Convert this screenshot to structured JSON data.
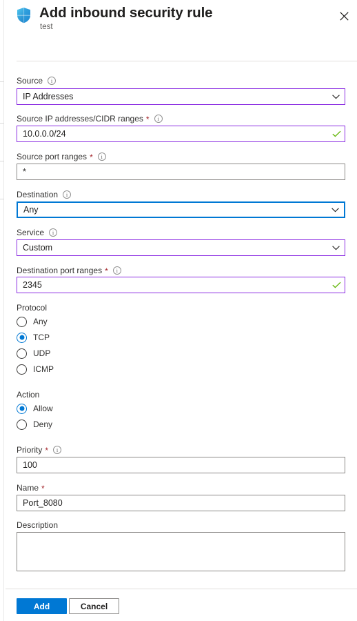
{
  "header": {
    "icon": "shield-icon",
    "title": "Add inbound security rule",
    "subtitle": "test",
    "close_label": "Close"
  },
  "colors": {
    "accent": "#0078d4",
    "modified_border": "#8a2be2",
    "neutral_border": "#8a8886",
    "required_star": "#a4262c",
    "valid_check": "#5db300",
    "label_text": "#323130"
  },
  "form": {
    "source": {
      "label": "Source",
      "required": false,
      "has_info": true,
      "value": "IP Addresses",
      "type": "dropdown",
      "state": "modified"
    },
    "source_ip": {
      "label": "Source IP addresses/CIDR ranges",
      "required": true,
      "has_info": true,
      "value": "10.0.0.0/24",
      "type": "text",
      "state": "modified",
      "valid": true
    },
    "source_port": {
      "label": "Source port ranges",
      "required": true,
      "has_info": true,
      "value": "*",
      "type": "text",
      "state": "default"
    },
    "destination": {
      "label": "Destination",
      "required": false,
      "has_info": true,
      "value": "Any",
      "type": "dropdown",
      "state": "focused"
    },
    "service": {
      "label": "Service",
      "required": false,
      "has_info": true,
      "value": "Custom",
      "type": "dropdown",
      "state": "modified"
    },
    "dest_port": {
      "label": "Destination port ranges",
      "required": true,
      "has_info": true,
      "value": "2345",
      "type": "text",
      "state": "modified",
      "valid": true
    },
    "protocol": {
      "label": "Protocol",
      "options": [
        {
          "label": "Any",
          "selected": false
        },
        {
          "label": "TCP",
          "selected": true
        },
        {
          "label": "UDP",
          "selected": false
        },
        {
          "label": "ICMP",
          "selected": false
        }
      ]
    },
    "action": {
      "label": "Action",
      "options": [
        {
          "label": "Allow",
          "selected": true
        },
        {
          "label": "Deny",
          "selected": false
        }
      ]
    },
    "priority": {
      "label": "Priority",
      "required": true,
      "has_info": true,
      "value": "100",
      "type": "text",
      "state": "default"
    },
    "name": {
      "label": "Name",
      "required": true,
      "has_info": false,
      "value": "Port_8080",
      "type": "text",
      "state": "default"
    },
    "description": {
      "label": "Description",
      "required": false,
      "has_info": false,
      "value": "",
      "type": "textarea",
      "state": "default"
    }
  },
  "footer": {
    "add_label": "Add",
    "cancel_label": "Cancel"
  }
}
